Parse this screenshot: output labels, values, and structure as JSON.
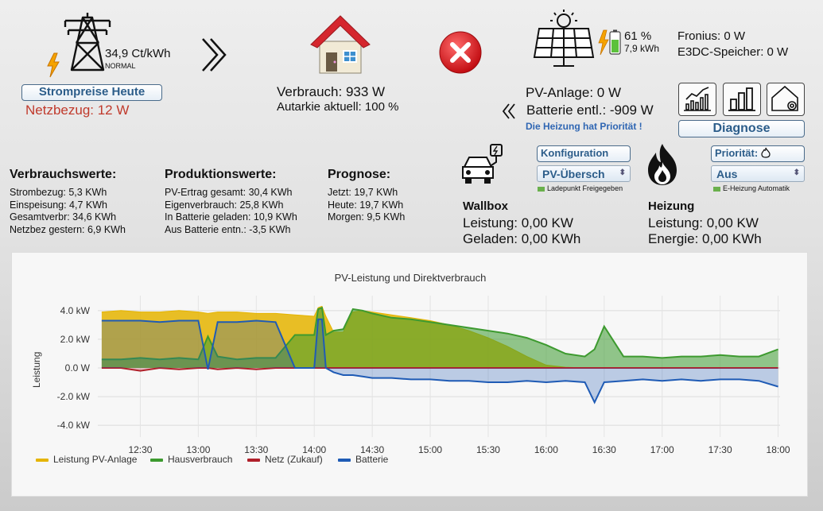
{
  "grid": {
    "price": "34,9 Ct/kWh",
    "tariff": "NORMAL",
    "price_button": "Strompreise Heute",
    "netzbezug": "Netzbezug: 12 W"
  },
  "house": {
    "verbrauch": "Verbrauch: 933 W",
    "autarkie": "Autarkie aktuell: 100 %"
  },
  "pv": {
    "soc": "61 %",
    "capacity": "7,9 kWh",
    "fronius": "Fronius: 0 W",
    "e3dc": "E3DC-Speicher: 0 W",
    "anlage": "PV-Anlage: 0 W",
    "batterie": "Batterie entl.: -909 W",
    "priority_msg": "Die Heizung hat Priorität !"
  },
  "buttons": {
    "diagnose": "Diagnose"
  },
  "stats": {
    "verbrauch": {
      "title": "Verbrauchswerte:",
      "lines": [
        "Strombezug: 5,3 KWh",
        "Einspeisung: 4,7 KWh",
        "Gesamtverbr: 34,6 KWh",
        "Netzbez gestern: 6,9 KWh"
      ]
    },
    "produktion": {
      "title": "Produktionswerte:",
      "lines": [
        "PV-Ertrag gesamt: 30,4 KWh",
        "Eigenverbrauch: 25,8 KWh",
        "In Batterie geladen: 10,9 KWh",
        "Aus Batterie entn.: -3,5 KWh"
      ]
    },
    "prognose": {
      "title": "Prognose:",
      "lines": [
        "Jetzt: 19,7 KWh",
        "Heute: 19,7 KWh",
        "Morgen: 9,5 KWh"
      ]
    }
  },
  "wallbox": {
    "config_label": "Konfiguration",
    "mode": "PV-Übersch",
    "legend": "Ladepunkt Freigegeben",
    "title": "Wallbox",
    "leistung": "Leistung: 0,00 KW",
    "geladen": "Geladen: 0,00 KWh"
  },
  "heizung": {
    "priority_label": "Priorität:",
    "mode": "Aus",
    "legend": "E-Heizung Automatik",
    "title": "Heizung",
    "leistung": "Leistung: 0,00 KW",
    "energie": "Energie: 0,00 KWh"
  },
  "colors": {
    "pv": "#e5b400",
    "haus": "#3d9a2f",
    "netz": "#b0202a",
    "batterie": "#1f5bb5"
  },
  "chart_data": {
    "type": "area",
    "title": "PV-Leistung und Direktverbrauch",
    "ylabel": "Leistung",
    "xlabel": "",
    "ylim": [
      -4.6,
      4.6
    ],
    "yticks": [
      "4.0 kW",
      "2.0 kW",
      "0.0 W",
      "-2.0 kW",
      "-4.0 kW"
    ],
    "ytick_values": [
      4,
      2,
      0,
      -2,
      -4
    ],
    "xticks": [
      "12:30",
      "13:00",
      "13:30",
      "14:00",
      "14:30",
      "15:00",
      "15:30",
      "16:00",
      "16:30",
      "17:00",
      "17:30",
      "18:00"
    ],
    "xtick_values": [
      "12:30",
      "13:00",
      "13:30",
      "14:00",
      "14:30",
      "15:00",
      "15:30",
      "16:00",
      "16:30",
      "17:00",
      "17:30",
      "18:00"
    ],
    "x": [
      "12:10",
      "12:20",
      "12:30",
      "12:40",
      "12:50",
      "13:00",
      "13:05",
      "13:10",
      "13:20",
      "13:30",
      "13:40",
      "13:50",
      "14:00",
      "14:02",
      "14:04",
      "14:06",
      "14:10",
      "14:15",
      "14:20",
      "14:25",
      "14:30",
      "14:40",
      "14:50",
      "15:00",
      "15:10",
      "15:20",
      "15:30",
      "15:40",
      "15:50",
      "16:00",
      "16:10",
      "16:20",
      "16:25",
      "16:30",
      "16:40",
      "16:50",
      "17:00",
      "17:10",
      "17:20",
      "17:30",
      "17:40",
      "17:50",
      "18:00"
    ],
    "series": [
      {
        "name": "Leistung PV-Anlage",
        "values": [
          3.9,
          4.0,
          3.9,
          3.9,
          4.0,
          3.9,
          3.8,
          3.9,
          3.9,
          3.8,
          3.8,
          3.7,
          3.6,
          4.2,
          4.3,
          3.6,
          2.5,
          2.5,
          3.9,
          4.0,
          3.9,
          3.7,
          3.5,
          3.3,
          3.0,
          2.6,
          2.1,
          1.5,
          0.8,
          0.2,
          0.05,
          0,
          0,
          0,
          0,
          0,
          0,
          0,
          0,
          0,
          0,
          0,
          0
        ]
      },
      {
        "name": "Hausverbrauch",
        "values": [
          0.6,
          0.6,
          0.7,
          0.6,
          0.7,
          0.6,
          2.2,
          0.8,
          0.6,
          0.7,
          0.7,
          2.3,
          2.3,
          4.1,
          4.2,
          2.3,
          2.6,
          2.7,
          4.1,
          4.0,
          3.8,
          3.5,
          3.4,
          3.2,
          3.0,
          2.8,
          2.6,
          2.4,
          2.1,
          1.6,
          1.0,
          0.8,
          1.3,
          2.9,
          0.8,
          0.8,
          0.7,
          0.8,
          0.8,
          0.9,
          0.8,
          0.8,
          1.3
        ]
      },
      {
        "name": "Netz (Zukauf)",
        "values": [
          0,
          0,
          -0.2,
          0,
          -0.1,
          0,
          0,
          -0.1,
          0,
          -0.1,
          0,
          0,
          0,
          0,
          0,
          0,
          0,
          0,
          0,
          0,
          0,
          0,
          0,
          0,
          0,
          0,
          0,
          0,
          0,
          0,
          0,
          0,
          0,
          0,
          0,
          0,
          0,
          0,
          0,
          0,
          0,
          0,
          0
        ]
      },
      {
        "name": "Batterie",
        "values": [
          3.3,
          3.3,
          3.3,
          3.2,
          3.3,
          3.3,
          -0.1,
          3.2,
          3.2,
          3.3,
          3.2,
          0.0,
          0.0,
          3.4,
          3.4,
          0.0,
          -0.3,
          -0.5,
          -0.5,
          -0.6,
          -0.7,
          -0.7,
          -0.8,
          -0.8,
          -0.9,
          -0.9,
          -1.0,
          -1.0,
          -0.9,
          -1.0,
          -0.9,
          -1.0,
          -2.4,
          -1.0,
          -0.9,
          -0.8,
          -0.9,
          -0.8,
          -0.9,
          -0.8,
          -0.8,
          -0.9,
          -1.3
        ]
      }
    ],
    "legend_position": "bottom-left",
    "grid": true
  }
}
